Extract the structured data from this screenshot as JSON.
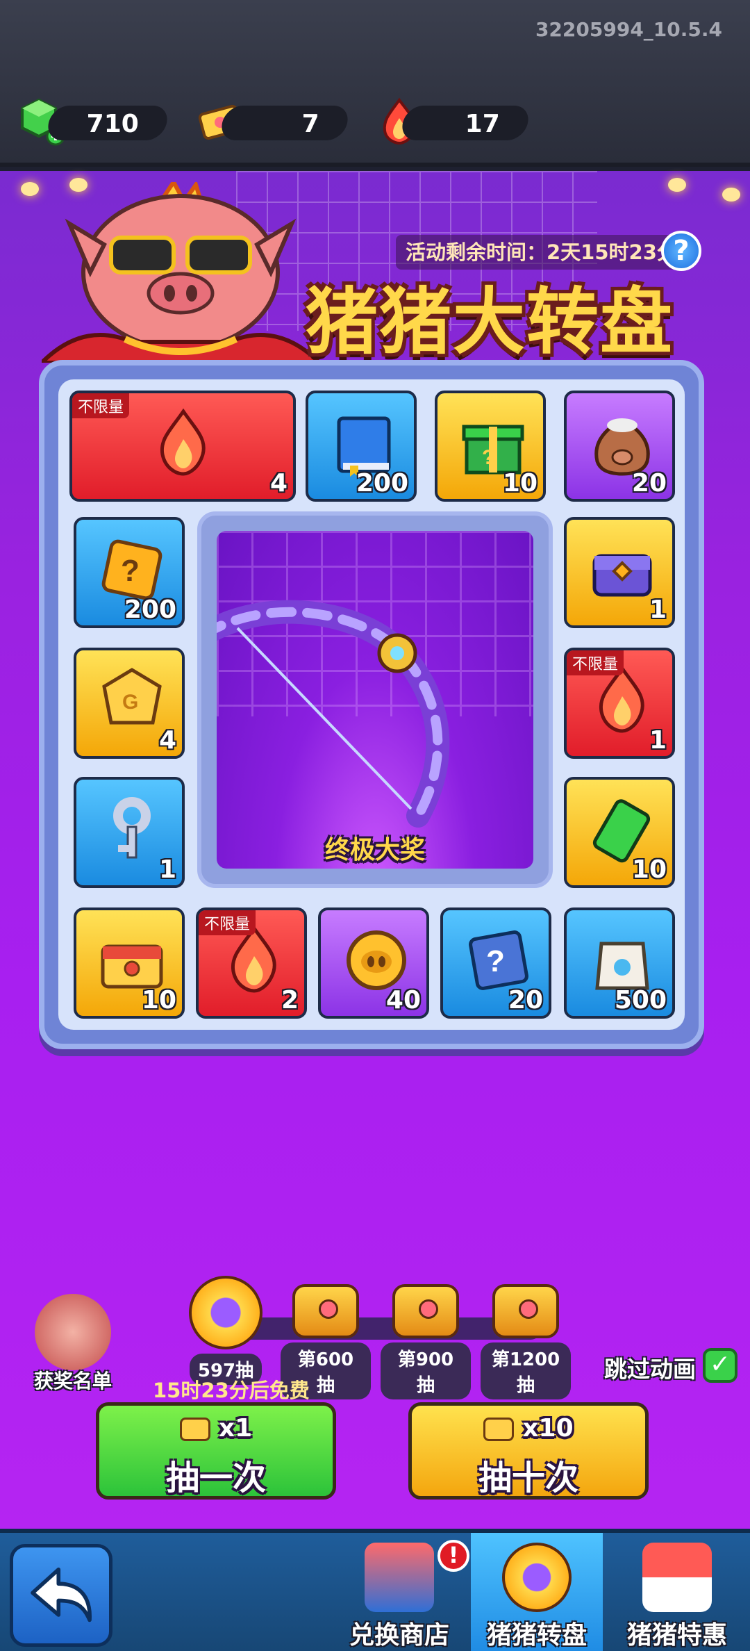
{
  "version": "32205994_10.5.4",
  "resources": [
    {
      "name": "gems",
      "icon": "green-gem-plus-icon",
      "value": "710"
    },
    {
      "name": "tickets",
      "icon": "gold-ticket-icon",
      "value": "7"
    },
    {
      "name": "fire",
      "icon": "red-flame-icon",
      "value": "17"
    }
  ],
  "event": {
    "timer": "活动剩余时间：2天15时23分",
    "title": "猪猪大转盘",
    "grand_prize_label": "终极大奖"
  },
  "prizes": [
    {
      "icon": "red-flame-icon",
      "qty": "4",
      "tag": "不限量",
      "color": "red"
    },
    {
      "icon": "blue-book-icon",
      "qty": "200",
      "tag": "",
      "color": "blue"
    },
    {
      "icon": "green-gift-box-icon",
      "qty": "10",
      "tag": "",
      "color": "gold"
    },
    {
      "icon": "pig-money-bag-icon",
      "qty": "20",
      "tag": "",
      "color": "purple"
    },
    {
      "icon": "mystery-box-icon",
      "qty": "200",
      "tag": "",
      "color": "blue"
    },
    {
      "icon": "purple-chest-icon",
      "qty": "1",
      "tag": "",
      "color": "gold"
    },
    {
      "icon": "gold-g-token-icon",
      "qty": "4",
      "tag": "",
      "color": "gold"
    },
    {
      "icon": "red-flame-icon",
      "qty": "1",
      "tag": "不限量",
      "color": "red"
    },
    {
      "icon": "silver-key-icon",
      "qty": "1",
      "tag": "",
      "color": "blue"
    },
    {
      "icon": "green-battery-icon",
      "qty": "10",
      "tag": "",
      "color": "gold"
    },
    {
      "icon": "gold-treasure-chest-icon",
      "qty": "10",
      "tag": "",
      "color": "gold"
    },
    {
      "icon": "red-flame-icon",
      "qty": "2",
      "tag": "不限量",
      "color": "red"
    },
    {
      "icon": "pig-coin-icon",
      "qty": "40",
      "tag": "",
      "color": "purple"
    },
    {
      "icon": "blue-mystery-cube-icon",
      "qty": "20",
      "tag": "",
      "color": "blue"
    },
    {
      "icon": "food-bag-icon",
      "qty": "500",
      "tag": "",
      "color": "blue"
    }
  ],
  "progress": {
    "current": "597抽",
    "current_count": 597,
    "milestones": [
      "第600抽",
      "第900抽",
      "第1200抽"
    ],
    "fill_fraction": 0.0
  },
  "winners_label": "获奖名单",
  "free_text": "15时23分后免费",
  "skip_animation": {
    "label": "跳过动画",
    "checked": true
  },
  "buttons": {
    "draw_one": {
      "count": "x1",
      "label": "抽一次"
    },
    "draw_ten": {
      "count": "x10",
      "label": "抽十次"
    }
  },
  "nav": {
    "tabs": [
      {
        "label": "兑换商店",
        "icon": "shop-stall-icon",
        "active": false,
        "badge": "!"
      },
      {
        "label": "猪猪转盘",
        "icon": "wheel-medal-icon",
        "active": true
      },
      {
        "label": "猪猪特惠",
        "icon": "special-offer-stall-icon",
        "active": false
      }
    ]
  }
}
